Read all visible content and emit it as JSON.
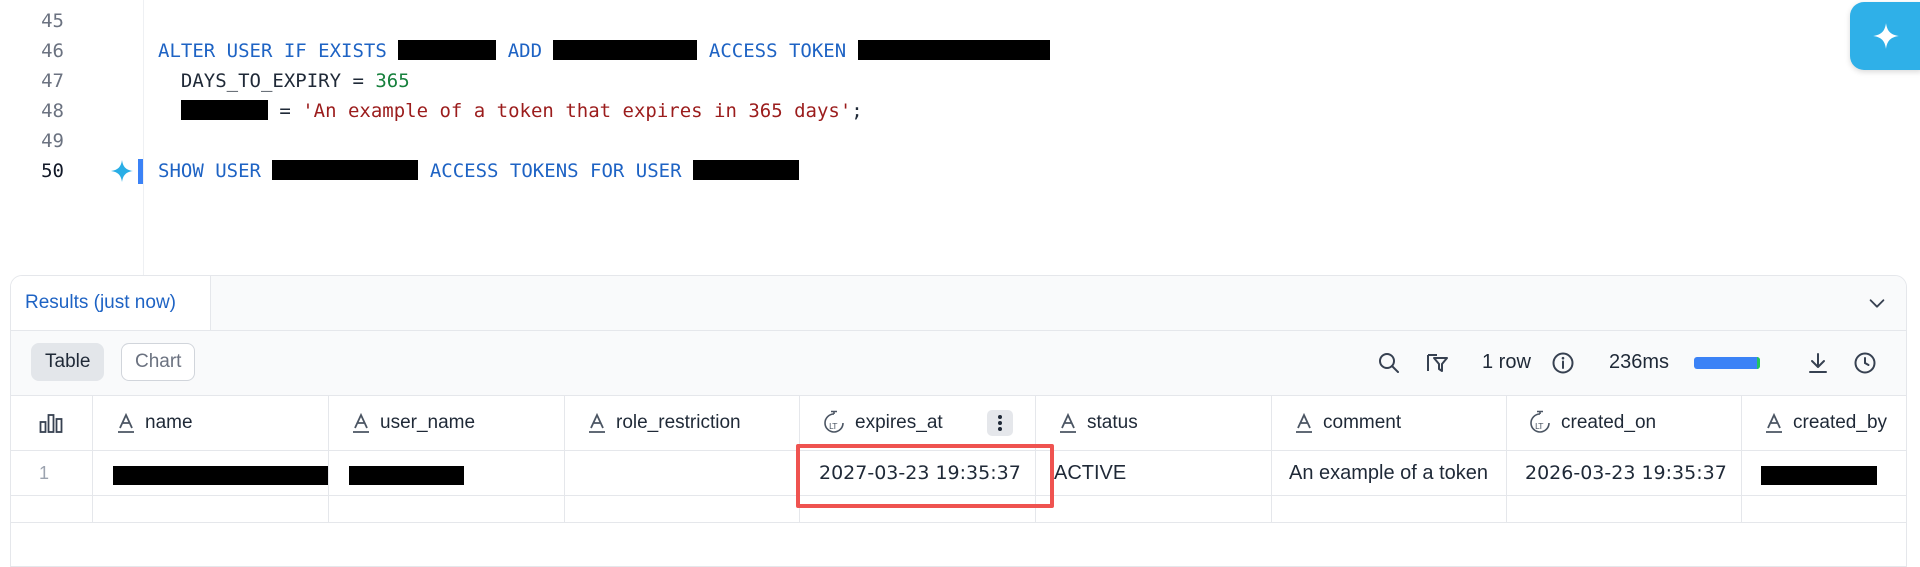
{
  "editor": {
    "lines": [
      {
        "number": "45"
      },
      {
        "number": "46",
        "t1": "ALTER USER IF EXISTS",
        "t2": "ADD",
        "t3": "ACCESS TOKEN"
      },
      {
        "number": "47",
        "t1": "DAYS_TO_EXPIRY = ",
        "num": "365"
      },
      {
        "number": "48",
        "eq": " = ",
        "str": "'An example of a token that expires in 365 days'",
        "semi": ";"
      },
      {
        "number": "49"
      },
      {
        "number": "50",
        "t1": "SHOW USER",
        "t2": "ACCESS TOKENS FOR USER"
      }
    ]
  },
  "results": {
    "tab_label": "Results (just now)",
    "view_table": "Table",
    "view_chart": "Chart",
    "row_count": "1 row",
    "elapsed": "236ms",
    "progress_fraction": 1.0,
    "columns": [
      {
        "label": "name",
        "type_icon": "text-type-icon"
      },
      {
        "label": "user_name",
        "type_icon": "text-type-icon"
      },
      {
        "label": "role_restriction",
        "type_icon": "text-type-icon"
      },
      {
        "label": "expires_at",
        "type_icon": "timestamp-type-icon"
      },
      {
        "label": "status",
        "type_icon": "text-type-icon"
      },
      {
        "label": "comment",
        "type_icon": "text-type-icon"
      },
      {
        "label": "created_on",
        "type_icon": "timestamp-type-icon"
      },
      {
        "label": "created_by",
        "type_icon": "text-type-icon"
      }
    ],
    "rows": [
      {
        "index": "1",
        "name": "",
        "user_name": "",
        "role_restriction": "",
        "expires_at": "2027-03-23 19:35:37",
        "status": "ACTIVE",
        "comment": "An example of a token",
        "created_on": "2026-03-23 19:35:37",
        "created_by": ""
      }
    ]
  },
  "colors": {
    "keyword": "#1e63c4",
    "number": "#16803c",
    "string": "#9b1c1c",
    "ai_button": "#2fb0e8",
    "highlight": "#ef5350",
    "progress": "#3b82f6"
  }
}
